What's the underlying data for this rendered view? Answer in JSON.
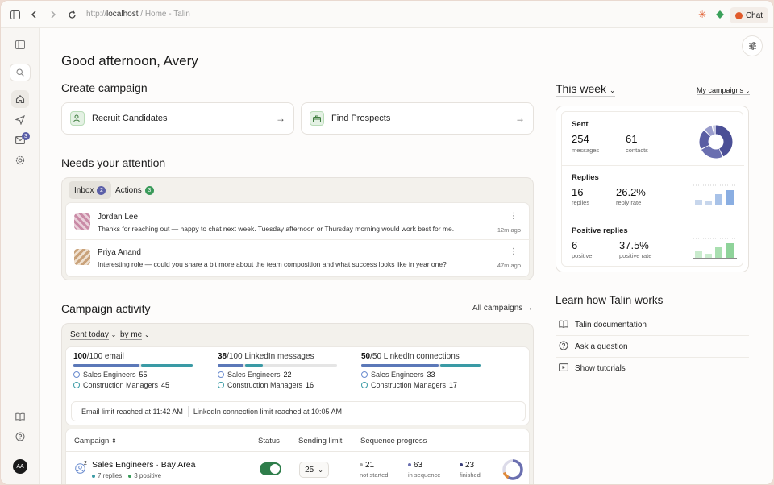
{
  "browser": {
    "url_scheme": "http://",
    "url_host": "localhost",
    "url_path": " / Home - Talin",
    "chat_label": "Chat"
  },
  "sidebar": {
    "mail_badge": "3",
    "user_initials": "AA"
  },
  "greeting": "Good afternoon, Avery",
  "create_campaign": {
    "title": "Create campaign",
    "cards": [
      {
        "label": "Recruit Candidates",
        "icon": "user-search-icon"
      },
      {
        "label": "Find Prospects",
        "icon": "briefcase-icon"
      }
    ]
  },
  "attention": {
    "title": "Needs your attention",
    "tabs": [
      {
        "label": "Inbox",
        "count": "2"
      },
      {
        "label": "Actions",
        "count": "3"
      }
    ],
    "messages": [
      {
        "name": "Jordan Lee",
        "text": "Thanks for reaching out — happy to chat next week. Tuesday afternoon or Thursday morning would work best for me.",
        "time": "12m ago"
      },
      {
        "name": "Priya Anand",
        "text": "Interesting role — could you share a bit more about the team composition and what success looks like in year one?",
        "time": "47m ago"
      }
    ]
  },
  "activity": {
    "title": "Campaign activity",
    "all_link": "All campaigns",
    "filter_sent": "Sent today",
    "filter_by": "by me",
    "limits": [
      {
        "used": "100",
        "total": "/100 email",
        "rows": [
          {
            "label": "Sales Engineers",
            "n": "55"
          },
          {
            "label": "Construction Managers",
            "n": "45"
          }
        ],
        "fill_pct": 100
      },
      {
        "used": "38",
        "total": "/100 LinkedIn messages",
        "rows": [
          {
            "label": "Sales Engineers",
            "n": "22"
          },
          {
            "label": "Construction Managers",
            "n": "16"
          }
        ],
        "fill_pct": 38
      },
      {
        "used": "50",
        "total": "/50 LinkedIn connections",
        "rows": [
          {
            "label": "Sales Engineers",
            "n": "33"
          },
          {
            "label": "Construction Managers",
            "n": "17"
          }
        ],
        "fill_pct": 100
      }
    ],
    "notice_email": "Email limit reached at 11:42 AM",
    "notice_linkedin": "LinkedIn connection limit reached at 10:05 AM",
    "table_headers": {
      "campaign": "Campaign",
      "status": "Status",
      "limit": "Sending limit",
      "progress": "Sequence progress"
    },
    "rows": [
      {
        "name": "Sales Engineers · Bay Area",
        "badge": "2",
        "replies": "7 replies",
        "positive": "3 positive",
        "limit": "25",
        "not_started": "21",
        "not_started_label": "not started",
        "in_sequence": "63",
        "in_sequence_label": "in sequence",
        "finished": "23",
        "finished_label": "finished"
      }
    ]
  },
  "week": {
    "title": "This week",
    "scope": "My campaigns",
    "sent": {
      "title": "Sent",
      "messages": "254",
      "messages_label": "messages",
      "contacts": "61",
      "contacts_label": "contacts"
    },
    "replies": {
      "title": "Replies",
      "count": "16",
      "count_label": "replies",
      "rate": "26.2%",
      "rate_label": "reply rate"
    },
    "positive": {
      "title": "Positive replies",
      "count": "6",
      "count_label": "positive",
      "rate": "37.5%",
      "rate_label": "positive rate"
    }
  },
  "learn": {
    "title": "Learn how Talin works",
    "items": [
      {
        "label": "Talin documentation",
        "icon": "book-icon"
      },
      {
        "label": "Ask a question",
        "icon": "question-icon"
      },
      {
        "label": "Show tutorials",
        "icon": "video-icon"
      }
    ]
  },
  "colors": {
    "accent": "#5b5fa8",
    "green": "#2e7d4a",
    "teal": "#3a9aa5",
    "blue": "#6a8ccf"
  }
}
